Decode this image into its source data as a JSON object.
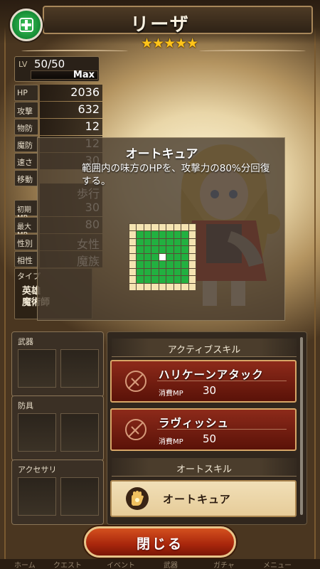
{
  "header": {
    "name": "リーザ",
    "stars": "★★★★★",
    "class_icon": "cross-shield-icon"
  },
  "level": {
    "label": "LV",
    "value": "50/50",
    "max_label": "Max"
  },
  "stats": [
    {
      "label": "HP",
      "value": "2036"
    },
    {
      "label": "攻撃",
      "value": "632"
    },
    {
      "label": "物防",
      "value": "12"
    },
    {
      "label": "魔防",
      "value": "12"
    },
    {
      "label": "速さ",
      "value": "30"
    },
    {
      "label": "移動",
      "value": "歩行"
    },
    {
      "label": "初期MP",
      "value": "30"
    },
    {
      "label": "最大MP",
      "value": "80"
    },
    {
      "label": "性別",
      "value": "女性"
    },
    {
      "label": "相性",
      "value": "魔族"
    }
  ],
  "type": {
    "label": "タイプ",
    "values": [
      "英雄",
      "魔術師"
    ]
  },
  "popup": {
    "title": "オートキュア",
    "description": "範囲内の味方のHPを、攻撃力の80%分回復する。"
  },
  "equipment": {
    "weapon_label": "武器",
    "armor_label": "防具",
    "accessory_label": "アクセサリ"
  },
  "skills": {
    "active_header": "アクティブスキル",
    "active": [
      {
        "name": "ハリケーンアタック",
        "mp_label": "消費MP",
        "mp": "30",
        "icon": "locked-skill-icon"
      },
      {
        "name": "ラヴィッシュ",
        "mp_label": "消費MP",
        "mp": "50",
        "icon": "locked-skill-icon"
      }
    ],
    "auto_header": "オートスキル",
    "auto": [
      {
        "name": "オートキュア",
        "icon": "healing-hand-icon"
      }
    ]
  },
  "close_button": "閉じる",
  "bottom_nav": [
    "ホーム",
    "クエスト",
    "イベント",
    "武器",
    "ガチャ",
    "メニュー"
  ]
}
